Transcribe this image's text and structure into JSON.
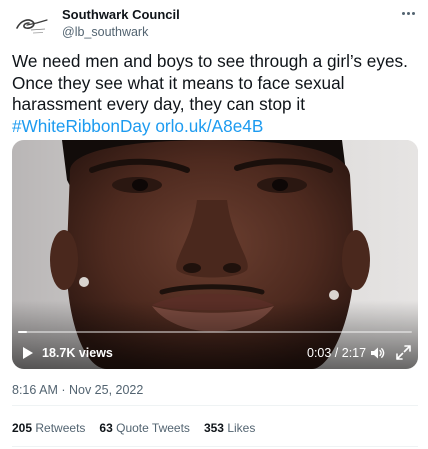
{
  "author": {
    "display_name": "Southwark Council",
    "handle": "@lb_southwark",
    "avatar_icon": "southwark-logo-icon",
    "avatar_logo_text": "Southwark Council"
  },
  "tweet": {
    "lines": [
      "We need men and boys to see through a girl’s eyes.",
      "Once they see what it means to face sexual",
      "harassment every day, they can stop it"
    ],
    "hashtag": "#WhiteRibbonDay",
    "url": "orlo.uk/A8e4B"
  },
  "video": {
    "views": "18.7K views",
    "time": "0:03 / 2:17",
    "progress": 0.022,
    "play_icon": "play-icon",
    "volume_icon": "volume-icon",
    "fullscreen_icon": "fullscreen-icon"
  },
  "meta": {
    "timestamp": "8:16 AM · Nov 25, 2022"
  },
  "stats": {
    "retweets_count": "205",
    "retweets_label": "Retweets",
    "quotes_count": "63",
    "quotes_label": "Quote Tweets",
    "likes_count": "353",
    "likes_label": "Likes"
  },
  "colors": {
    "link": "#1d9bf0",
    "secondary_text": "#536471",
    "primary_text": "#0f1419"
  }
}
